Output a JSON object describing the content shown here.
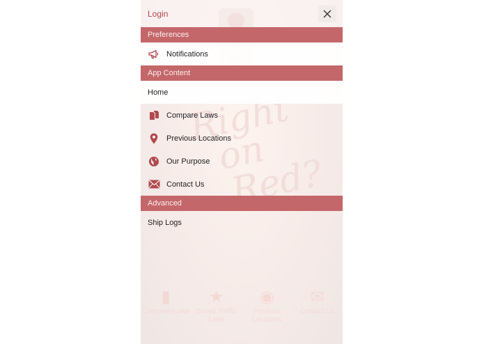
{
  "drawer": {
    "login_label": "Login",
    "sections": {
      "preferences": "Preferences",
      "app_content": "App Content",
      "advanced": "Advanced"
    },
    "items": {
      "notifications": "Notifications",
      "home": "Home",
      "compare_laws": "Compare Laws",
      "previous_locations": "Previous Locations",
      "our_purpose": "Our Purpose",
      "contact_us": "Contact Us",
      "ship_logs": "Ship Logs"
    },
    "icons": {
      "close": "close-icon",
      "notifications": "megaphone-icon",
      "compare_laws": "documents-icon",
      "previous_locations": "map-pin-icon",
      "our_purpose": "globe-icon",
      "contact_us": "envelope-icon"
    }
  },
  "background": {
    "logo_text": [
      "Right",
      "on",
      "Red?"
    ],
    "tabs": [
      "Compare Laws",
      "Saved Traffic Laws",
      "Previous Locations",
      "Contact Us"
    ]
  },
  "colors": {
    "accent": "#c4676a",
    "link": "#b3474c",
    "icon": "#b04a4f"
  }
}
